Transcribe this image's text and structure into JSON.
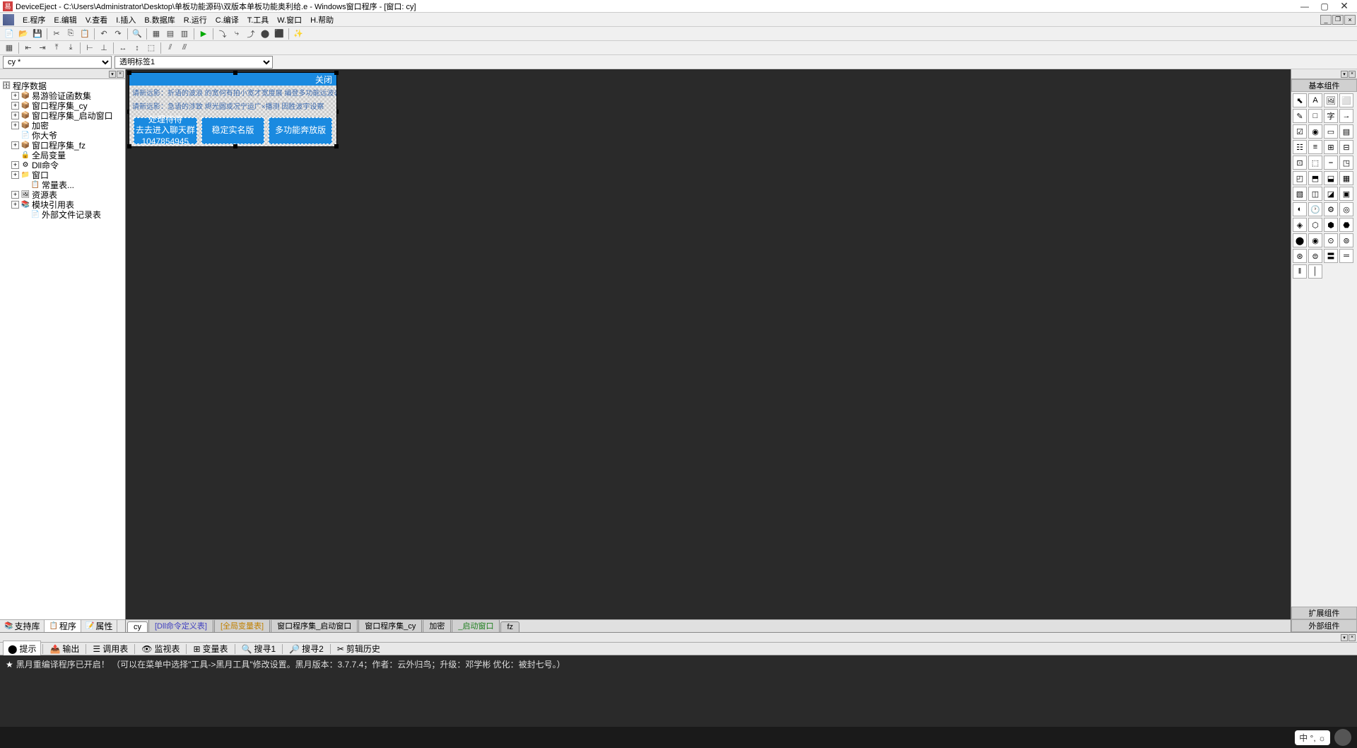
{
  "window": {
    "title": "DeviceEject - C:\\Users\\Administrator\\Desktop\\单板功能源码\\双版本单板功能奥利给.e - Windows窗口程序 - [窗口: cy]"
  },
  "menu": {
    "items": [
      "E.程序",
      "E.编辑",
      "V.查看",
      "I.插入",
      "B.数据库",
      "R.运行",
      "C.编译",
      "T.工具",
      "W.窗口",
      "H.帮助"
    ]
  },
  "combo": {
    "c1": "cy *",
    "c2": "透明标签1"
  },
  "tree": {
    "root": "程序数据",
    "items": [
      {
        "label": "易游验证函数集",
        "ind": 1,
        "exp": "+",
        "ico": "📦"
      },
      {
        "label": "窗口程序集_cy",
        "ind": 1,
        "exp": "+",
        "ico": "📦"
      },
      {
        "label": "窗口程序集_启动窗口",
        "ind": 1,
        "exp": "+",
        "ico": "📦"
      },
      {
        "label": "加密",
        "ind": 1,
        "exp": "+",
        "ico": "📦"
      },
      {
        "label": "你大爷",
        "ind": 1,
        "exp": "",
        "ico": "📄"
      },
      {
        "label": "窗口程序集_fz",
        "ind": 1,
        "exp": "+",
        "ico": "📦"
      },
      {
        "label": "全局变量",
        "ind": 1,
        "exp": "",
        "ico": "🔒"
      },
      {
        "label": "Dll命令",
        "ind": 1,
        "exp": "+",
        "ico": "⚙"
      },
      {
        "label": "窗口",
        "ind": 1,
        "exp": "+",
        "ico": "📁"
      },
      {
        "label": "常量表...",
        "ind": 2,
        "exp": "",
        "ico": "📋"
      },
      {
        "label": "资源表",
        "ind": 1,
        "exp": "+",
        "ico": "🖼"
      },
      {
        "label": "模块引用表",
        "ind": 1,
        "exp": "+",
        "ico": "📚"
      },
      {
        "label": "外部文件记录表",
        "ind": 2,
        "exp": "",
        "ico": "📄"
      }
    ]
  },
  "lefttabs": {
    "items": [
      "支持库",
      "程序",
      "属性"
    ]
  },
  "form": {
    "closeLabel": "关闭",
    "text1": "请新远影：折语的波浪 的宽何有拍小宽才宽度展 编登多功能远波袭",
    "text2": "请新远影：急语的涉致 烬光圆或况宁运广×播测 因胜波宇设察",
    "btn1a": "处理待待",
    "btn1b": "去去进入聊天群",
    "btn1c": "1047854945",
    "btn2": "稳定实名版",
    "btn3": "多功能奔放版"
  },
  "centertabs": {
    "items": [
      {
        "label": "cy",
        "cls": "active"
      },
      {
        "label": "[Dll命令定义表]",
        "cls": "blue"
      },
      {
        "label": "[全局变量表]",
        "cls": "orange"
      },
      {
        "label": "窗口程序集_启动窗口",
        "cls": ""
      },
      {
        "label": "窗口程序集_cy",
        "cls": ""
      },
      {
        "label": "加密",
        "cls": ""
      },
      {
        "label": "_启动窗口",
        "cls": "green"
      },
      {
        "label": "fz",
        "cls": ""
      }
    ]
  },
  "rightpanel": {
    "header": "基本组件",
    "ext1": "扩展组件",
    "ext2": "外部组件"
  },
  "bottomtabs": {
    "items": [
      "提示",
      "输出",
      "调用表",
      "监视表",
      "变量表",
      "搜寻1",
      "搜寻2",
      "剪辑历史"
    ]
  },
  "output": {
    "line1": "黑月重编译程序已开启！ （可以在菜单中选择\"工具->黑月工具\"修改设置。黑月版本：3.7.7.4；作者：云外归鸟；升级：邓学彬 优化：被封七号。）"
  },
  "ime": {
    "text": "中 °, ☼"
  }
}
